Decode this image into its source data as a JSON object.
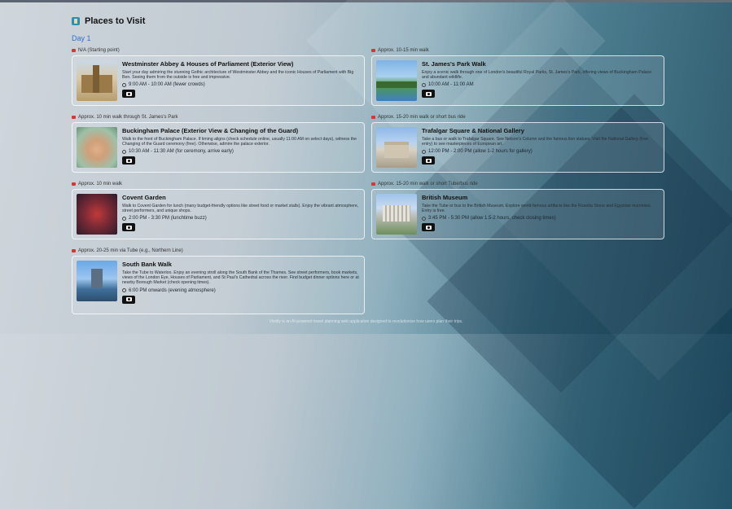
{
  "section": {
    "icon": "map-icon",
    "title": "Places to Visit"
  },
  "day_label": "Day 1",
  "left_column": [
    {
      "transit": "N/A (Starting point)",
      "title": "Westminster Abbey & Houses of Parliament (Exterior View)",
      "description": "Start your day admiring the stunning Gothic architecture of Westminster Abbey and the iconic Houses of Parliament with Big Ben. Seeing them from the outside is free and impressive.",
      "time": "9:00 AM - 10:00 AM (fewer crowds)",
      "thumb": "westminster"
    },
    {
      "transit": "Approx. 10 min walk through St. James's Park",
      "title": "Buckingham Palace (Exterior View & Changing of the Guard)",
      "description": "Walk to the front of Buckingham Palace. If timing aligns (check schedule online, usually 11:00 AM on select days), witness the Changing of the Guard ceremony (free). Otherwise, admire the palace exterior.",
      "time": "10:30 AM - 11:30 AM (for ceremony, arrive early)",
      "thumb": "buckingham"
    },
    {
      "transit": "Approx. 10 min walk",
      "title": "Covent Garden",
      "description": "Walk to Covent Garden for lunch (many budget-friendly options like street food or market stalls). Enjoy the vibrant atmosphere, street performers, and unique shops.",
      "time": "2:00 PM - 3:30 PM (lunchtime buzz)",
      "thumb": "covent"
    },
    {
      "transit": "Approx. 20-25 min via Tube (e.g., Northern Line)",
      "title": "South Bank Walk",
      "description": "Take the Tube to Waterloo. Enjoy an evening stroll along the South Bank of the Thames. See street performers, book markets, views of the London Eye, Houses of Parliament, and St Paul's Cathedral across the river. Find budget dinner options here or at nearby Borough Market (check opening times).",
      "time": "6:00 PM onwards (evening atmosphere)",
      "thumb": "southbank"
    }
  ],
  "right_column": [
    {
      "transit": "Approx. 10-15 min walk",
      "title": "St. James's Park Walk",
      "description": "Enjoy a scenic walk through one of London's beautiful Royal Parks, St. James's Park, offering views of Buckingham Palace and abundant wildlife.",
      "time": "10:00 AM - 11:00 AM",
      "thumb": "stjames"
    },
    {
      "transit": "Approx. 15-20 min walk or short bus ride",
      "title": "Trafalgar Square & National Gallery",
      "description": "Take a bus or walk to Trafalgar Square. See Nelson's Column and the famous lion statues. Visit the National Gallery (free entry) to see masterpieces of European art.",
      "time": "12:00 PM - 2:00 PM (allow 1-2 hours for gallery)",
      "thumb": "trafalgar"
    },
    {
      "transit": "Approx. 15-20 min walk or short Tube/bus ride",
      "title": "British Museum",
      "description": "Take the Tube or bus to the British Museum. Explore world-famous artifacts like the Rosetta Stone and Egyptian mummies. Entry is free.",
      "time": "3:45 PM - 5:30 PM (allow 1.5-2 hours, check closing times)",
      "thumb": "museum"
    }
  ],
  "footer": "Vividly is an AI-powered travel planning web application designed to revolutionize how users plan their trips."
}
